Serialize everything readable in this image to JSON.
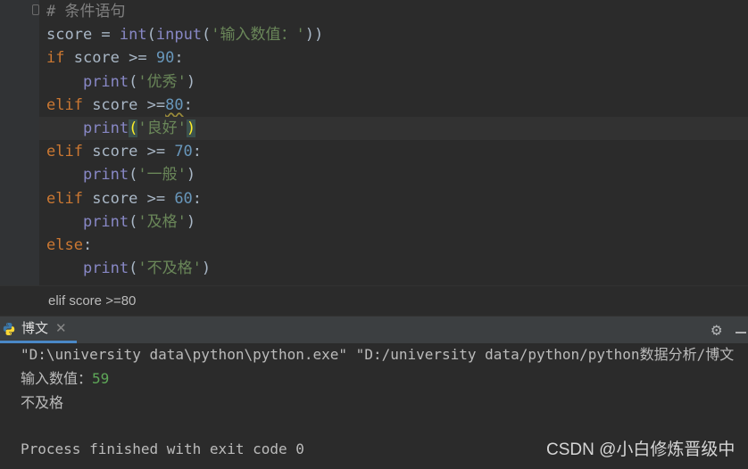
{
  "editor": {
    "lines": [
      {
        "parts": [
          {
            "cls": "cm",
            "text": "# 条件语句"
          }
        ]
      },
      {
        "parts": [
          {
            "cls": "plain",
            "text": "score = "
          },
          {
            "cls": "fn",
            "text": "int"
          },
          {
            "cls": "plain",
            "text": "("
          },
          {
            "cls": "fn",
            "text": "input"
          },
          {
            "cls": "plain",
            "text": "("
          },
          {
            "cls": "str",
            "text": "'输入数值：'"
          },
          {
            "cls": "plain",
            "text": "))"
          }
        ]
      },
      {
        "parts": [
          {
            "cls": "kw",
            "text": "if"
          },
          {
            "cls": "plain",
            "text": " score >= "
          },
          {
            "cls": "num",
            "text": "90"
          },
          {
            "cls": "plain",
            "text": ":"
          }
        ]
      },
      {
        "parts": [
          {
            "cls": "plain",
            "text": "    "
          },
          {
            "cls": "fn",
            "text": "print"
          },
          {
            "cls": "plain",
            "text": "("
          },
          {
            "cls": "str",
            "text": "'优秀'"
          },
          {
            "cls": "plain",
            "text": ")"
          }
        ]
      },
      {
        "parts": [
          {
            "cls": "kw",
            "text": "elif"
          },
          {
            "cls": "plain",
            "text": " score >="
          },
          {
            "cls": "num warn",
            "text": "80"
          },
          {
            "cls": "plain",
            "text": ":"
          }
        ]
      },
      {
        "current": true,
        "parts": [
          {
            "cls": "plain",
            "text": "    "
          },
          {
            "cls": "fn",
            "text": "print"
          },
          {
            "cls": "brace-hl",
            "text": "("
          },
          {
            "cls": "str",
            "text": "'良好'"
          },
          {
            "cls": "brace-hl",
            "text": ")"
          }
        ]
      },
      {
        "parts": [
          {
            "cls": "kw",
            "text": "elif"
          },
          {
            "cls": "plain",
            "text": " score >= "
          },
          {
            "cls": "num",
            "text": "70"
          },
          {
            "cls": "plain",
            "text": ":"
          }
        ]
      },
      {
        "parts": [
          {
            "cls": "plain",
            "text": "    "
          },
          {
            "cls": "fn",
            "text": "print"
          },
          {
            "cls": "plain",
            "text": "("
          },
          {
            "cls": "str",
            "text": "'一般'"
          },
          {
            "cls": "plain",
            "text": ")"
          }
        ]
      },
      {
        "parts": [
          {
            "cls": "kw",
            "text": "elif"
          },
          {
            "cls": "plain",
            "text": " score >= "
          },
          {
            "cls": "num",
            "text": "60"
          },
          {
            "cls": "plain",
            "text": ":"
          }
        ]
      },
      {
        "parts": [
          {
            "cls": "plain",
            "text": "    "
          },
          {
            "cls": "fn",
            "text": "print"
          },
          {
            "cls": "plain",
            "text": "("
          },
          {
            "cls": "str",
            "text": "'及格'"
          },
          {
            "cls": "plain",
            "text": ")"
          }
        ]
      },
      {
        "parts": [
          {
            "cls": "kw",
            "text": "else"
          },
          {
            "cls": "plain",
            "text": ":"
          }
        ]
      },
      {
        "parts": [
          {
            "cls": "plain",
            "text": "    "
          },
          {
            "cls": "fn",
            "text": "print"
          },
          {
            "cls": "plain",
            "text": "("
          },
          {
            "cls": "str",
            "text": "'不及格'"
          },
          {
            "cls": "plain",
            "text": ")"
          }
        ]
      }
    ]
  },
  "breadcrumb": {
    "text": "elif score >=80"
  },
  "run_panel": {
    "tab_label": "博文",
    "close_glyph": "✕",
    "gear_glyph": "⚙",
    "icon": "python-icon"
  },
  "console": {
    "command": "\"D:\\university data\\python\\python.exe\" \"D:/university data/python/python数据分析/博文",
    "prompt": "输入数值：",
    "input_value": "59",
    "output": "不及格",
    "exit_message": "Process finished with exit code 0"
  },
  "watermark": "CSDN @小白修炼晋级中",
  "colors": {
    "background": "#2b2b2b",
    "keyword": "#cc7832",
    "builtin": "#8888c6",
    "number": "#6897bb",
    "string": "#6a8759",
    "comment": "#808080",
    "tab_underline": "#4a88c7",
    "console_input": "#5ea758"
  }
}
